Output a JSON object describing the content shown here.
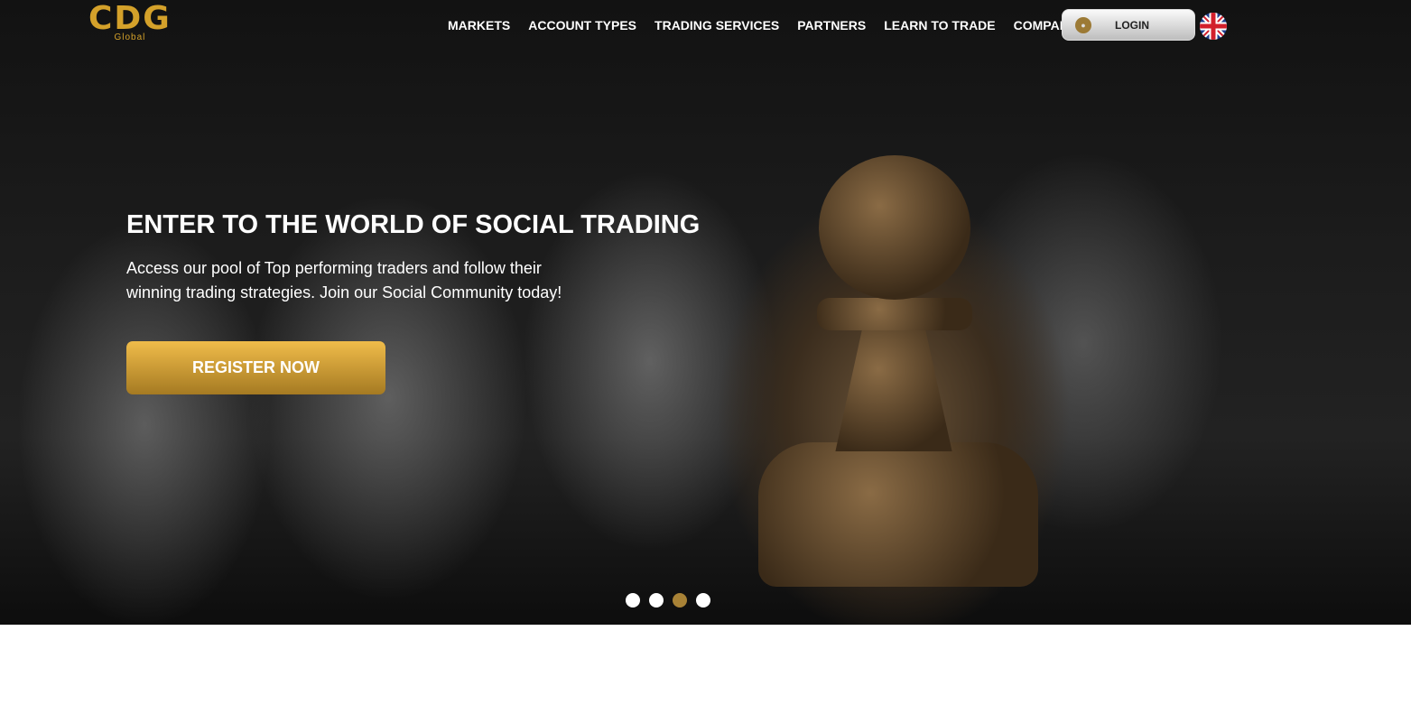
{
  "logo": {
    "text": "CDG",
    "subtext": "Global"
  },
  "nav": {
    "items": [
      {
        "label": "MARKETS"
      },
      {
        "label": "ACCOUNT TYPES"
      },
      {
        "label": "TRADING SERVICES"
      },
      {
        "label": "PARTNERS"
      },
      {
        "label": "LEARN TO TRADE"
      },
      {
        "label": "COMPANY"
      }
    ],
    "login_label": "LOGIN",
    "language": "English (UK flag)"
  },
  "hero": {
    "title": "ENTER TO THE WORLD OF SOCIAL TRADING",
    "subtitle": "Access our pool of Top performing traders and follow their winning trading strategies. Join our Social Community today!",
    "cta_label": "REGISTER NOW",
    "slide_count": 4,
    "active_slide": 3
  },
  "colors": {
    "accent": "#d4a12a",
    "active_dot": "#a88236"
  }
}
